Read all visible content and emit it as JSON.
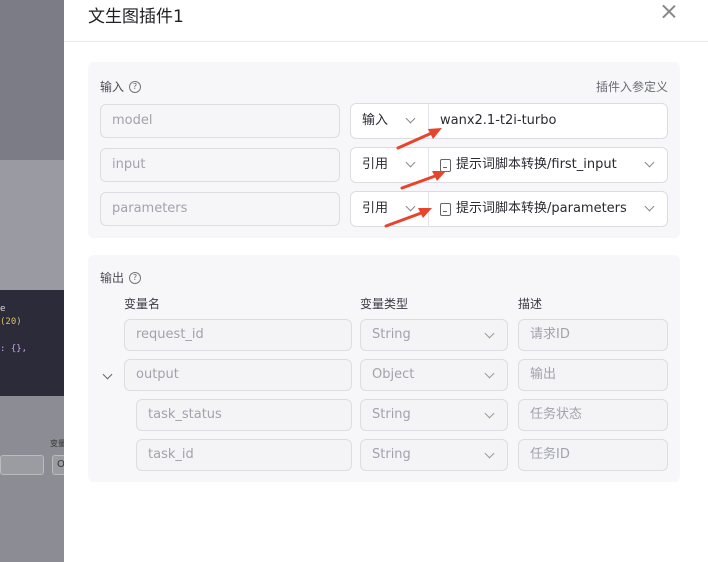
{
  "background": {
    "code_lines": [
      "e",
      "(20)",
      ": {},"
    ],
    "label": "变量",
    "box_text": "O"
  },
  "drawer": {
    "title": "文生图插件1"
  },
  "input_section": {
    "label": "输入",
    "help_icon": "question-circle-icon",
    "define_link": "插件入参定义",
    "rows": [
      {
        "name": "model",
        "mode": "输入",
        "value": "wanx2.1-t2i-turbo"
      },
      {
        "name": "input",
        "mode": "引用",
        "value": "提示词脚本转换/first_input"
      },
      {
        "name": "parameters",
        "mode": "引用",
        "value": "提示词脚本转换/parameters"
      }
    ]
  },
  "output_section": {
    "label": "输出",
    "help_icon": "question-circle-icon",
    "columns": [
      "变量名",
      "变量类型",
      "描述"
    ],
    "rows": [
      {
        "name": "request_id",
        "type": "String",
        "desc": "请求ID"
      },
      {
        "name": "output",
        "type": "Object",
        "desc": "输出"
      },
      {
        "name": "task_status",
        "type": "String",
        "desc": "任务状态"
      },
      {
        "name": "task_id",
        "type": "String",
        "desc": "任务ID"
      }
    ]
  },
  "colors": {
    "arrow": "#e8442b",
    "card_bg": "#f7f7fa"
  }
}
